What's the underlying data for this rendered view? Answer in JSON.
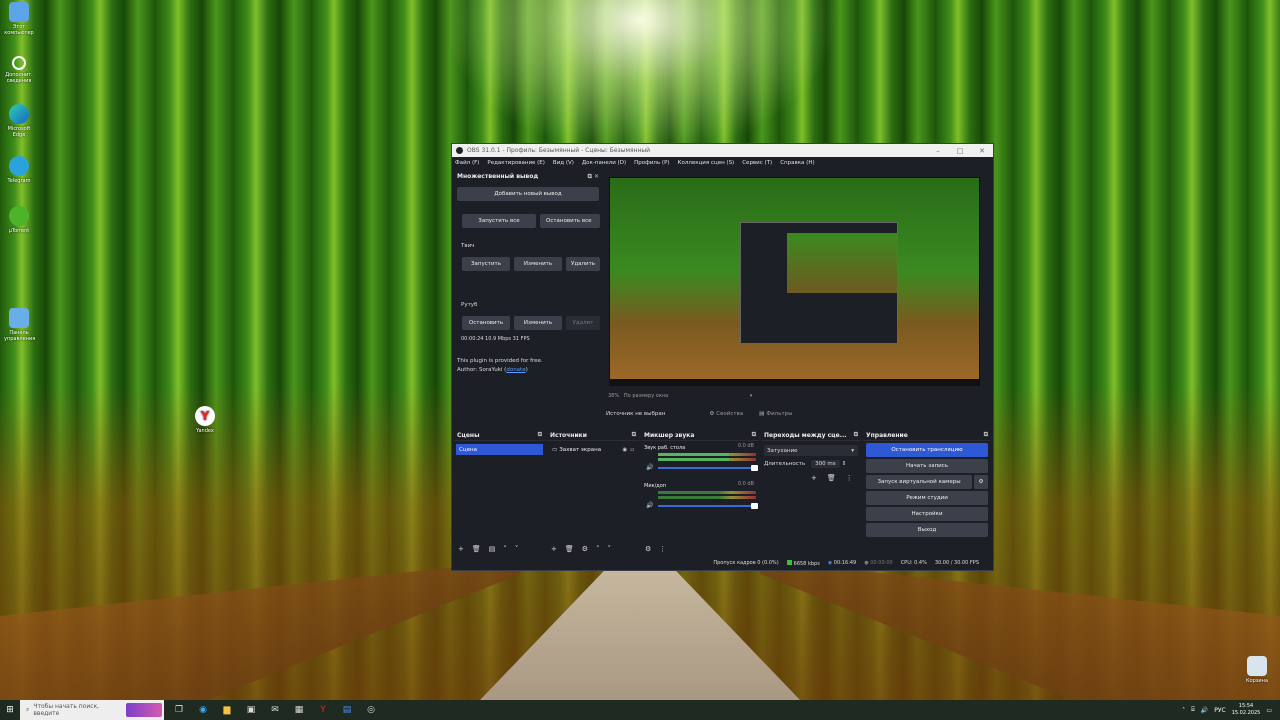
{
  "desktop": {
    "icons": [
      {
        "label": "Этот компьютер"
      },
      {
        "label": "Дополнит. сведения"
      },
      {
        "label": "Microsoft Edge"
      },
      {
        "label": "Telegram"
      },
      {
        "label": "µTorrent"
      },
      {
        "label": "Панель управления"
      },
      {
        "label": "Yandex"
      },
      {
        "label": "Корзина"
      }
    ]
  },
  "obs": {
    "title": "OBS 31.0.1 - Профиль: Безымянный - Сцены: Безымянный",
    "menu": [
      "Файл (F)",
      "Редактирование (E)",
      "Вид (V)",
      "Док-панели (D)",
      "Профиль (P)",
      "Коллекция сцен (S)",
      "Сервис (T)",
      "Справка (H)"
    ],
    "multi_output": {
      "title": "Множественный вывод",
      "add_button": "Добавить новый вывод",
      "start_all": "Запустить все",
      "stop_all": "Остановить все",
      "target1_name": "Твич",
      "target1_start": "Запустить",
      "target1_edit": "Изменить",
      "target1_delete": "Удалить",
      "target2_name": "Рутуб",
      "target2_stop": "Остановить",
      "target2_edit": "Изменить",
      "target2_delete": "Удалит",
      "target2_stats": "00:00:24  10.9 Mbps  31 FPS",
      "plugin_note": "This plugin is provided for free.",
      "author_prefix": "Author: SoraYuki (",
      "author_link": "donate",
      "author_suffix": ")"
    },
    "preview": {
      "zoom": "38%",
      "fit": "По размеру окна"
    },
    "source_bar": {
      "no_source": "Источник не выбран",
      "properties": "Свойства",
      "filters": "Фильтры"
    },
    "scenes": {
      "title": "Сцены",
      "items": [
        "Сцена"
      ]
    },
    "sources": {
      "title": "Источники",
      "items": [
        "Захват экрана"
      ]
    },
    "mixer": {
      "title": "Микшер звука",
      "channels": [
        {
          "name": "Звук раб. стола",
          "db": "0.0 dB",
          "level": 0.72
        },
        {
          "name": "Мик/доп",
          "db": "0.0 dB",
          "level": 0.0
        }
      ]
    },
    "transitions": {
      "title": "Переходы между сце...",
      "selected": "Затухание",
      "duration_label": "Длительность",
      "duration_value": "300 ms"
    },
    "controls": {
      "title": "Управление",
      "buttons": [
        "Остановить трансляцию",
        "Начать запись",
        "Запуск виртуальной камеры",
        "Режим студии",
        "Настройки",
        "Выход"
      ]
    },
    "status": {
      "dropped": "Пропуск кадров 0 (0.0%)",
      "bitrate": "6658 kbps",
      "stream_time": "00:16:49",
      "rec_time": "00:00:00",
      "cpu": "CPU: 0.4%",
      "fps": "30.00 / 30.00 FPS"
    }
  },
  "taskbar": {
    "search_placeholder": "Чтобы начать поиск, введите",
    "lang": "РУС",
    "time": "15:54",
    "date": "15.02.2025"
  },
  "colors": {
    "accent": "#2f58d4",
    "obs_bg": "#1d1f26",
    "button_bg": "#3c404b"
  }
}
